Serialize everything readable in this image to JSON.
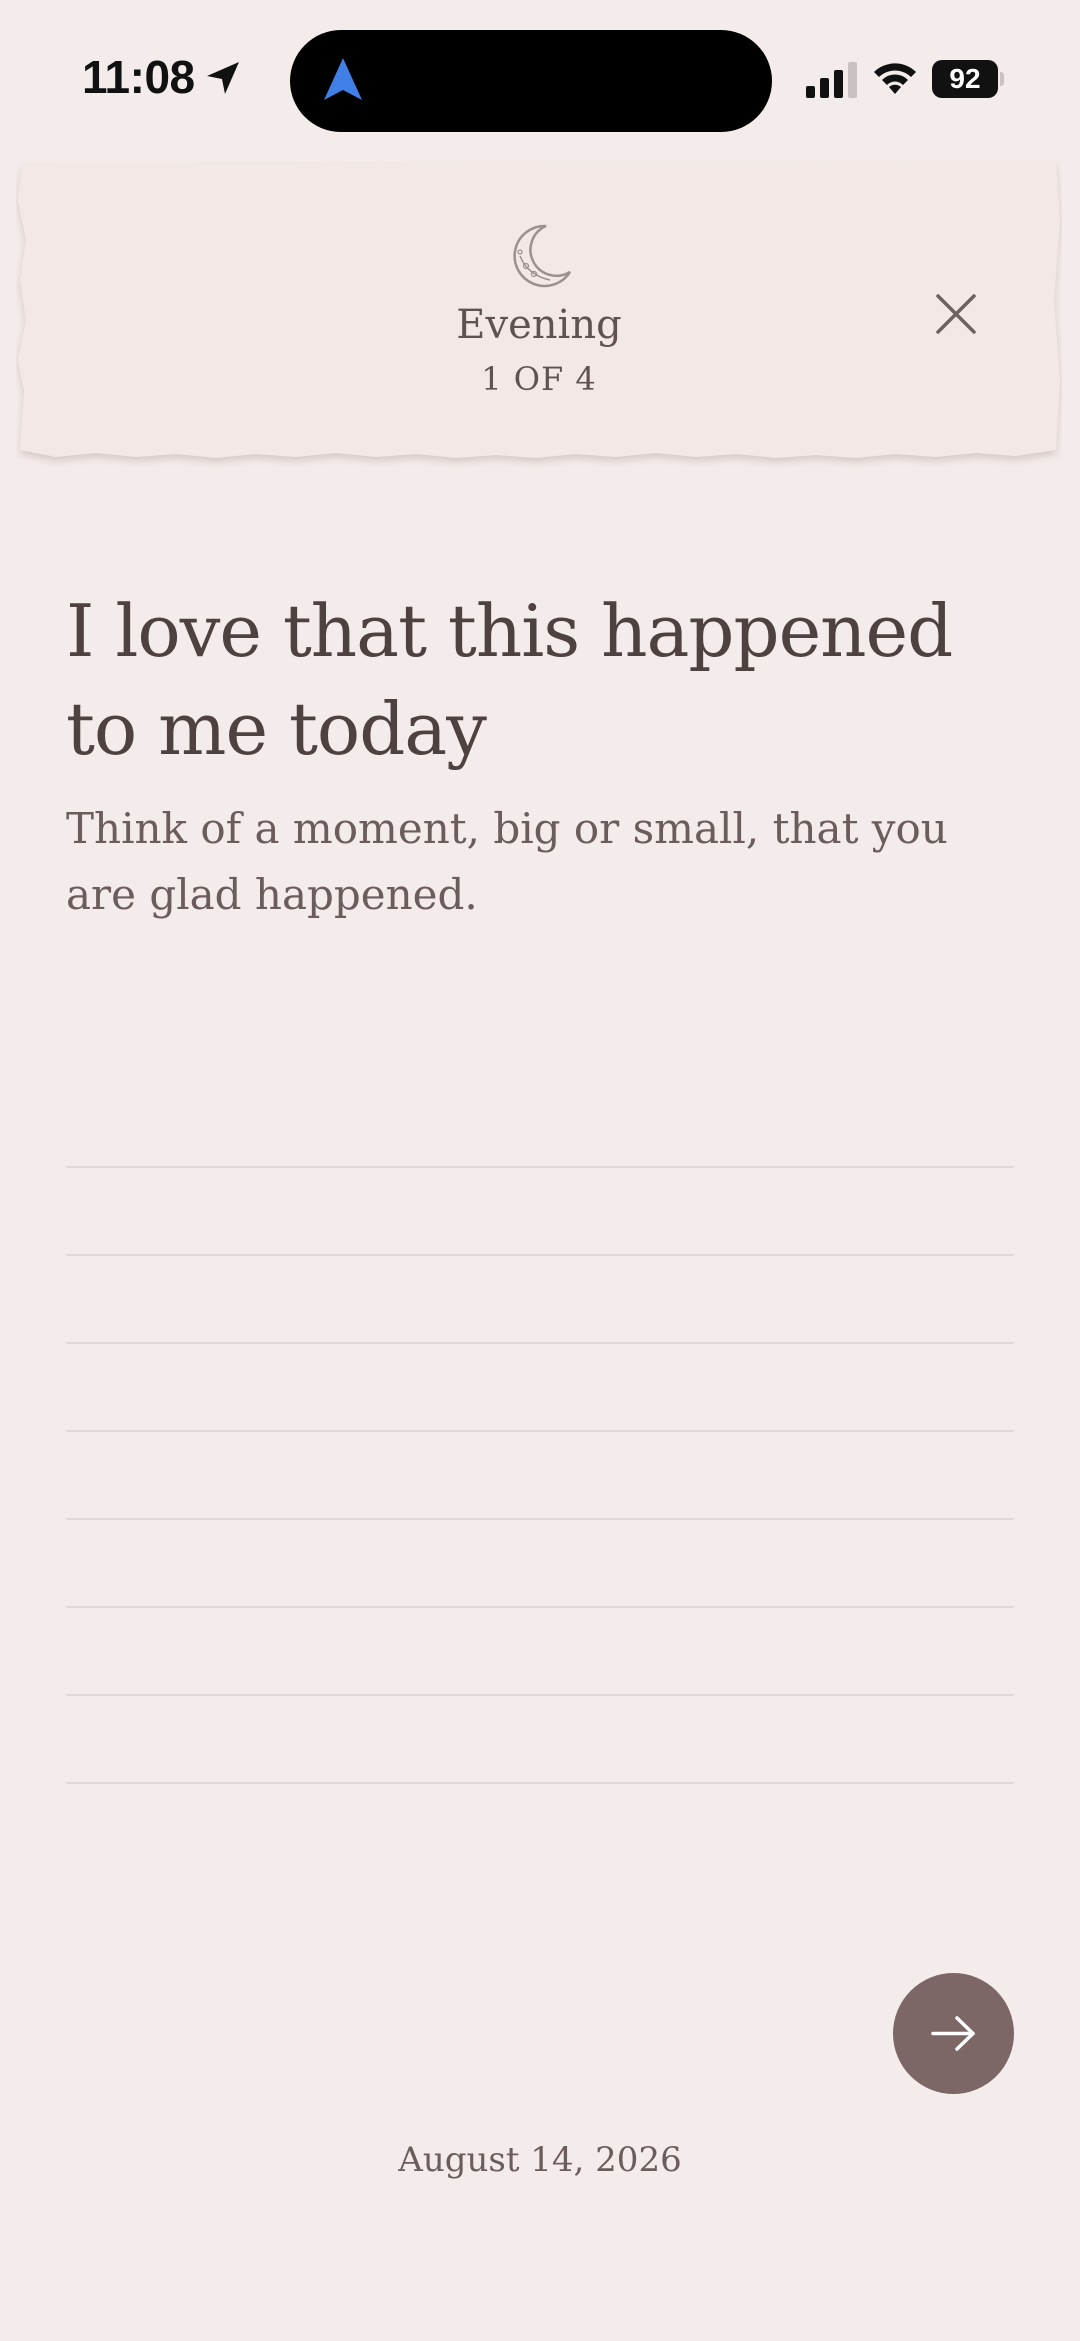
{
  "status_bar": {
    "time": "11:08",
    "battery": "92"
  },
  "header": {
    "title": "Evening",
    "progress": "1 OF 4",
    "icon": "crescent-moon-icon"
  },
  "prompt": {
    "title": "I love that this happened to me today",
    "subtitle": "Think of a moment, big or small, that you are glad happened."
  },
  "footer": {
    "date": "August 14, 2026"
  },
  "colors": {
    "background": "#f4ecea",
    "paper": "#f1e8e6",
    "accent_button": "#7c6666",
    "text": "#4e4240"
  }
}
